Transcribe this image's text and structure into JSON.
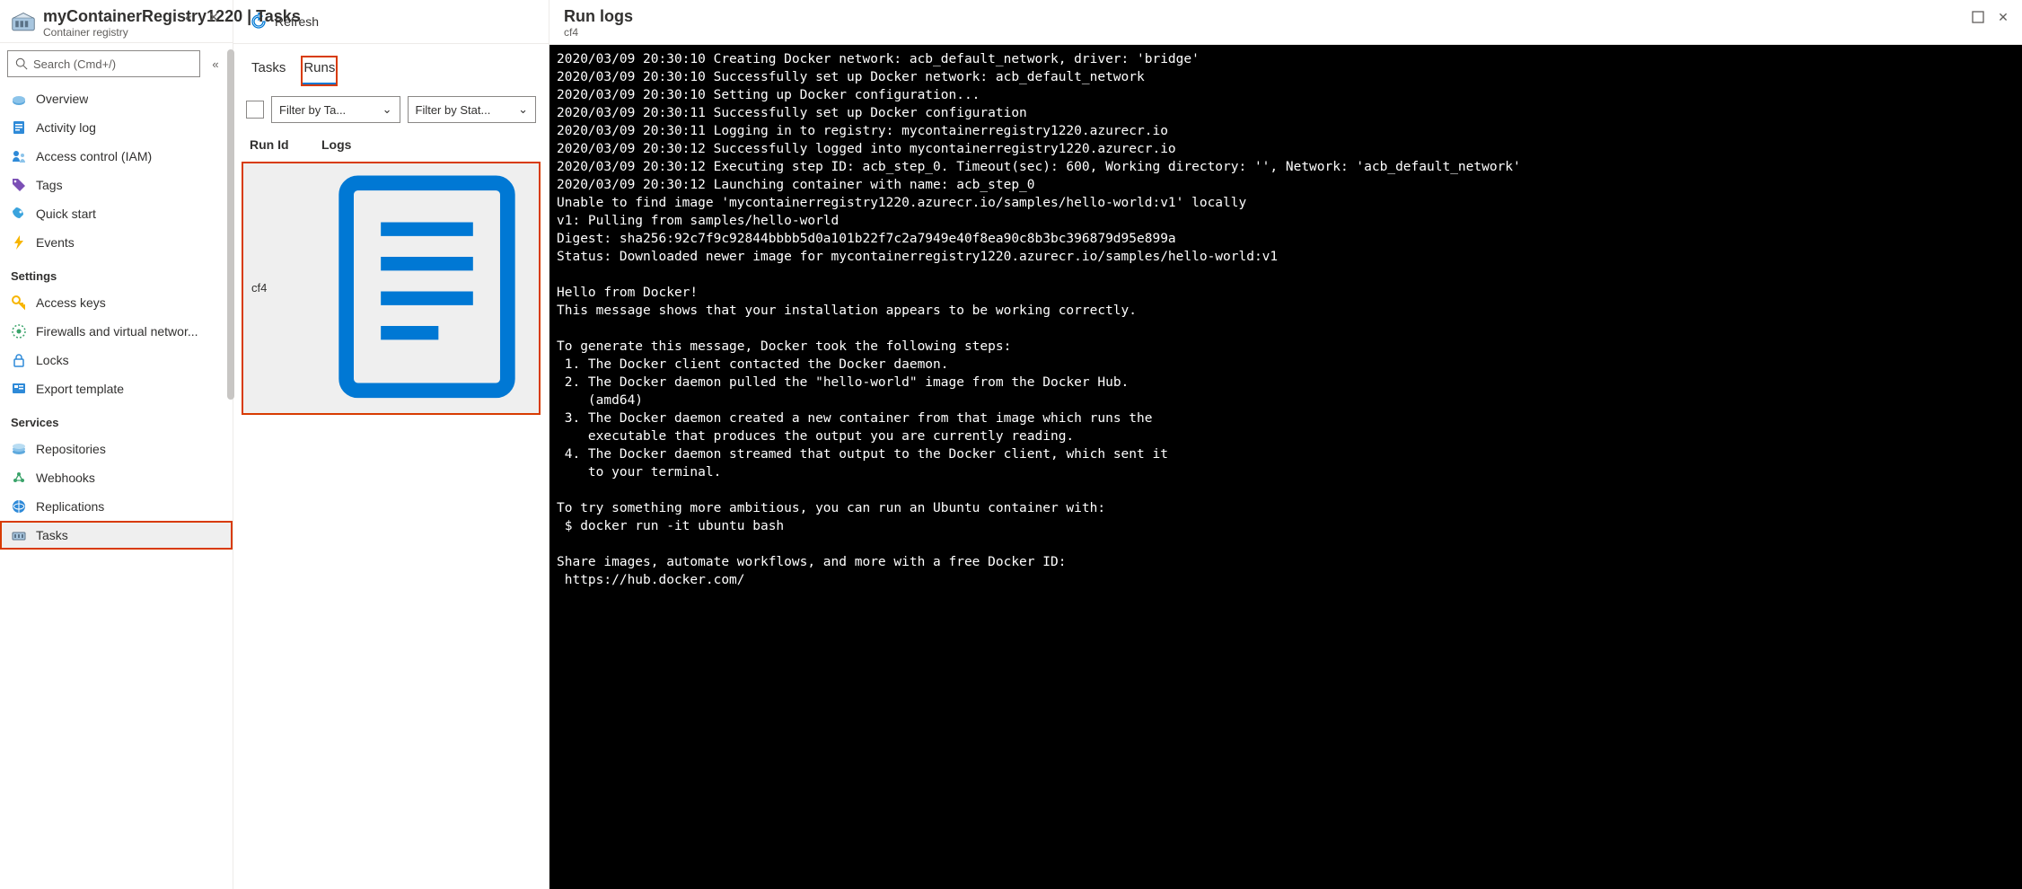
{
  "header": {
    "title": "myContainerRegistry1220 | Tasks",
    "subtitle": "Container registry"
  },
  "search": {
    "placeholder": "Search (Cmd+/)"
  },
  "nav": {
    "top": [
      {
        "label": "Overview"
      },
      {
        "label": "Activity log"
      },
      {
        "label": "Access control (IAM)"
      },
      {
        "label": "Tags"
      },
      {
        "label": "Quick start"
      },
      {
        "label": "Events"
      }
    ],
    "settings_title": "Settings",
    "settings": [
      {
        "label": "Access keys"
      },
      {
        "label": "Firewalls and virtual networ..."
      },
      {
        "label": "Locks"
      },
      {
        "label": "Export template"
      }
    ],
    "services_title": "Services",
    "services": [
      {
        "label": "Repositories"
      },
      {
        "label": "Webhooks"
      },
      {
        "label": "Replications"
      },
      {
        "label": "Tasks"
      }
    ]
  },
  "mid": {
    "refresh": "Refresh",
    "tab_tasks": "Tasks",
    "tab_runs": "Runs",
    "filter_task": "Filter by Ta...",
    "filter_status": "Filter by Stat...",
    "col_runid": "Run Id",
    "col_logs": "Logs",
    "rows": [
      {
        "runid": "cf4"
      }
    ]
  },
  "logs": {
    "title": "Run logs",
    "subtitle": "cf4",
    "content": "2020/03/09 20:30:10 Creating Docker network: acb_default_network, driver: 'bridge'\n2020/03/09 20:30:10 Successfully set up Docker network: acb_default_network\n2020/03/09 20:30:10 Setting up Docker configuration...\n2020/03/09 20:30:11 Successfully set up Docker configuration\n2020/03/09 20:30:11 Logging in to registry: mycontainerregistry1220.azurecr.io\n2020/03/09 20:30:12 Successfully logged into mycontainerregistry1220.azurecr.io\n2020/03/09 20:30:12 Executing step ID: acb_step_0. Timeout(sec): 600, Working directory: '', Network: 'acb_default_network'\n2020/03/09 20:30:12 Launching container with name: acb_step_0\nUnable to find image 'mycontainerregistry1220.azurecr.io/samples/hello-world:v1' locally\nv1: Pulling from samples/hello-world\nDigest: sha256:92c7f9c92844bbbb5d0a101b22f7c2a7949e40f8ea90c8b3bc396879d95e899a\nStatus: Downloaded newer image for mycontainerregistry1220.azurecr.io/samples/hello-world:v1\n\nHello from Docker!\nThis message shows that your installation appears to be working correctly.\n\nTo generate this message, Docker took the following steps:\n 1. The Docker client contacted the Docker daemon.\n 2. The Docker daemon pulled the \"hello-world\" image from the Docker Hub.\n    (amd64)\n 3. The Docker daemon created a new container from that image which runs the\n    executable that produces the output you are currently reading.\n 4. The Docker daemon streamed that output to the Docker client, which sent it\n    to your terminal.\n\nTo try something more ambitious, you can run an Ubuntu container with:\n $ docker run -it ubuntu bash\n\nShare images, automate workflows, and more with a free Docker ID:\n https://hub.docker.com/"
  }
}
